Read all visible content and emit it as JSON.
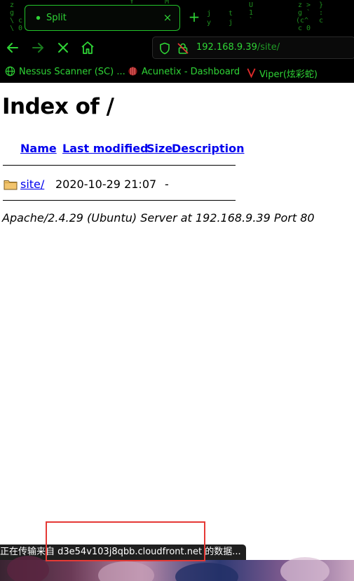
{
  "browser": {
    "tab": {
      "title": "Split",
      "close_glyph": "×",
      "favicon": "spinner-dot"
    },
    "new_tab_glyph": "+",
    "nav": {
      "back": "arrow-left-icon",
      "forward": "arrow-right-icon",
      "stop": "close-icon",
      "home": "home-icon"
    },
    "url": {
      "host": "192.168.9.39",
      "path": "/site/"
    },
    "bookmarks": [
      {
        "label": "Nessus Scanner (SC) ...",
        "icon": "globe-icon"
      },
      {
        "label": "Acunetix - Dashboard",
        "icon": "acunetix-icon"
      },
      {
        "label": "Viper(炫彩蛇)",
        "icon": "viper-v-icon"
      }
    ],
    "accent_color": "#2fd436"
  },
  "page": {
    "title": "Index of /",
    "columns": [
      "Name",
      "Last modified",
      "Size",
      "Description"
    ],
    "rows": [
      {
        "name": "site/",
        "modified": "2020-10-29 21:07",
        "size": "-",
        "description": "",
        "icon": "folder-icon"
      }
    ],
    "address": "Apache/2.4.29 (Ubuntu) Server at 192.168.9.39 Port 80"
  },
  "status_bar": {
    "text": "正在传输来自 d3e54v103j8qbb.cloudfront.net 的数据..."
  },
  "highlight_color": "#e53935"
}
